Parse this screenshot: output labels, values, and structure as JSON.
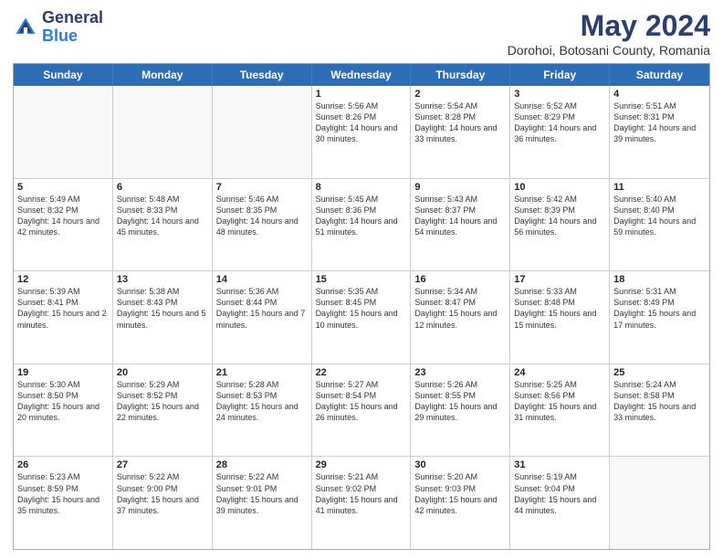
{
  "header": {
    "logo_general": "General",
    "logo_blue": "Blue",
    "main_title": "May 2024",
    "subtitle": "Dorohoi, Botosani County, Romania"
  },
  "weekdays": [
    "Sunday",
    "Monday",
    "Tuesday",
    "Wednesday",
    "Thursday",
    "Friday",
    "Saturday"
  ],
  "rows": [
    [
      {
        "day": "",
        "info": "",
        "empty": true
      },
      {
        "day": "",
        "info": "",
        "empty": true
      },
      {
        "day": "",
        "info": "",
        "empty": true
      },
      {
        "day": "1",
        "info": "Sunrise: 5:56 AM\nSunset: 8:26 PM\nDaylight: 14 hours and 30 minutes."
      },
      {
        "day": "2",
        "info": "Sunrise: 5:54 AM\nSunset: 8:28 PM\nDaylight: 14 hours and 33 minutes."
      },
      {
        "day": "3",
        "info": "Sunrise: 5:52 AM\nSunset: 8:29 PM\nDaylight: 14 hours and 36 minutes."
      },
      {
        "day": "4",
        "info": "Sunrise: 5:51 AM\nSunset: 8:31 PM\nDaylight: 14 hours and 39 minutes."
      }
    ],
    [
      {
        "day": "5",
        "info": "Sunrise: 5:49 AM\nSunset: 8:32 PM\nDaylight: 14 hours and 42 minutes."
      },
      {
        "day": "6",
        "info": "Sunrise: 5:48 AM\nSunset: 8:33 PM\nDaylight: 14 hours and 45 minutes."
      },
      {
        "day": "7",
        "info": "Sunrise: 5:46 AM\nSunset: 8:35 PM\nDaylight: 14 hours and 48 minutes."
      },
      {
        "day": "8",
        "info": "Sunrise: 5:45 AM\nSunset: 8:36 PM\nDaylight: 14 hours and 51 minutes."
      },
      {
        "day": "9",
        "info": "Sunrise: 5:43 AM\nSunset: 8:37 PM\nDaylight: 14 hours and 54 minutes."
      },
      {
        "day": "10",
        "info": "Sunrise: 5:42 AM\nSunset: 8:39 PM\nDaylight: 14 hours and 56 minutes."
      },
      {
        "day": "11",
        "info": "Sunrise: 5:40 AM\nSunset: 8:40 PM\nDaylight: 14 hours and 59 minutes."
      }
    ],
    [
      {
        "day": "12",
        "info": "Sunrise: 5:39 AM\nSunset: 8:41 PM\nDaylight: 15 hours and 2 minutes."
      },
      {
        "day": "13",
        "info": "Sunrise: 5:38 AM\nSunset: 8:43 PM\nDaylight: 15 hours and 5 minutes."
      },
      {
        "day": "14",
        "info": "Sunrise: 5:36 AM\nSunset: 8:44 PM\nDaylight: 15 hours and 7 minutes."
      },
      {
        "day": "15",
        "info": "Sunrise: 5:35 AM\nSunset: 8:45 PM\nDaylight: 15 hours and 10 minutes."
      },
      {
        "day": "16",
        "info": "Sunrise: 5:34 AM\nSunset: 8:47 PM\nDaylight: 15 hours and 12 minutes."
      },
      {
        "day": "17",
        "info": "Sunrise: 5:33 AM\nSunset: 8:48 PM\nDaylight: 15 hours and 15 minutes."
      },
      {
        "day": "18",
        "info": "Sunrise: 5:31 AM\nSunset: 8:49 PM\nDaylight: 15 hours and 17 minutes."
      }
    ],
    [
      {
        "day": "19",
        "info": "Sunrise: 5:30 AM\nSunset: 8:50 PM\nDaylight: 15 hours and 20 minutes."
      },
      {
        "day": "20",
        "info": "Sunrise: 5:29 AM\nSunset: 8:52 PM\nDaylight: 15 hours and 22 minutes."
      },
      {
        "day": "21",
        "info": "Sunrise: 5:28 AM\nSunset: 8:53 PM\nDaylight: 15 hours and 24 minutes."
      },
      {
        "day": "22",
        "info": "Sunrise: 5:27 AM\nSunset: 8:54 PM\nDaylight: 15 hours and 26 minutes."
      },
      {
        "day": "23",
        "info": "Sunrise: 5:26 AM\nSunset: 8:55 PM\nDaylight: 15 hours and 29 minutes."
      },
      {
        "day": "24",
        "info": "Sunrise: 5:25 AM\nSunset: 8:56 PM\nDaylight: 15 hours and 31 minutes."
      },
      {
        "day": "25",
        "info": "Sunrise: 5:24 AM\nSunset: 8:58 PM\nDaylight: 15 hours and 33 minutes."
      }
    ],
    [
      {
        "day": "26",
        "info": "Sunrise: 5:23 AM\nSunset: 8:59 PM\nDaylight: 15 hours and 35 minutes."
      },
      {
        "day": "27",
        "info": "Sunrise: 5:22 AM\nSunset: 9:00 PM\nDaylight: 15 hours and 37 minutes."
      },
      {
        "day": "28",
        "info": "Sunrise: 5:22 AM\nSunset: 9:01 PM\nDaylight: 15 hours and 39 minutes."
      },
      {
        "day": "29",
        "info": "Sunrise: 5:21 AM\nSunset: 9:02 PM\nDaylight: 15 hours and 41 minutes."
      },
      {
        "day": "30",
        "info": "Sunrise: 5:20 AM\nSunset: 9:03 PM\nDaylight: 15 hours and 42 minutes."
      },
      {
        "day": "31",
        "info": "Sunrise: 5:19 AM\nSunset: 9:04 PM\nDaylight: 15 hours and 44 minutes."
      },
      {
        "day": "",
        "info": "",
        "empty": true
      }
    ]
  ]
}
